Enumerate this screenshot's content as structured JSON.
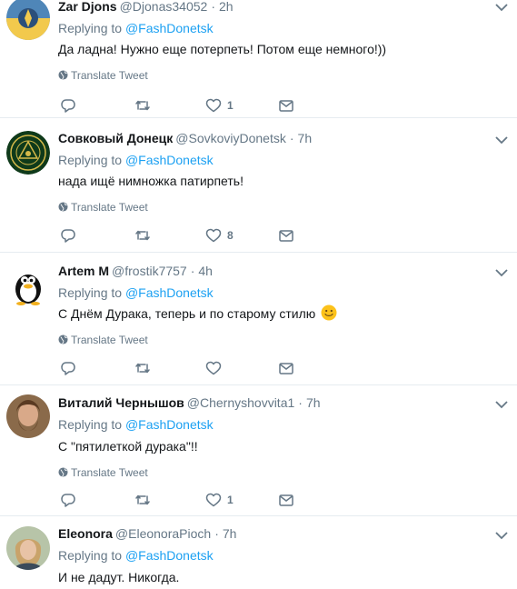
{
  "tweets": [
    {
      "name": "Zar Djons",
      "handle": "@Djonas34052",
      "time": "2h",
      "replying_prefix": "Replying to ",
      "replying_to": "@FashDonetsk",
      "text": "Да ладна! Нужно еще потерпеть! Потом еще немного!))",
      "translate": "Translate Tweet",
      "reply_count": "",
      "retweet_count": "",
      "like_count": "1"
    },
    {
      "name": "Совковый Донецк",
      "handle": "@SovkoviyDonetsk",
      "time": "7h",
      "replying_prefix": "Replying to ",
      "replying_to": "@FashDonetsk",
      "text": "нада ищё нимножка патирпеть!",
      "translate": "Translate Tweet",
      "reply_count": "",
      "retweet_count": "",
      "like_count": "8"
    },
    {
      "name": "Artem M",
      "handle": "@frostik7757",
      "time": "4h",
      "replying_prefix": "Replying to ",
      "replying_to": "@FashDonetsk",
      "text": "С Днём Дурака, теперь и по старому стилю",
      "translate": "Translate Tweet",
      "reply_count": "",
      "retweet_count": "",
      "like_count": ""
    },
    {
      "name": "Виталий Чернышов",
      "handle": "@Chernyshovvita1",
      "time": "7h",
      "replying_prefix": "Replying to ",
      "replying_to": "@FashDonetsk",
      "text": "С \"пятилеткой дурака\"!!",
      "translate": "Translate Tweet",
      "reply_count": "",
      "retweet_count": "",
      "like_count": "1"
    },
    {
      "name": "Eleonora",
      "handle": "@EleonoraPioch",
      "time": "7h",
      "replying_prefix": "Replying to ",
      "replying_to": "@FashDonetsk",
      "text": "И не дадут. Никогда."
    }
  ],
  "colors": {
    "link": "#1da1f2",
    "muted": "#657786",
    "text": "#14171a",
    "divider": "#e6ecf0"
  },
  "icons": {
    "reply": "reply-icon",
    "retweet": "retweet-icon",
    "like": "heart-icon",
    "dm": "envelope-icon",
    "translate": "globe-icon",
    "caret": "chevron-down-icon"
  }
}
